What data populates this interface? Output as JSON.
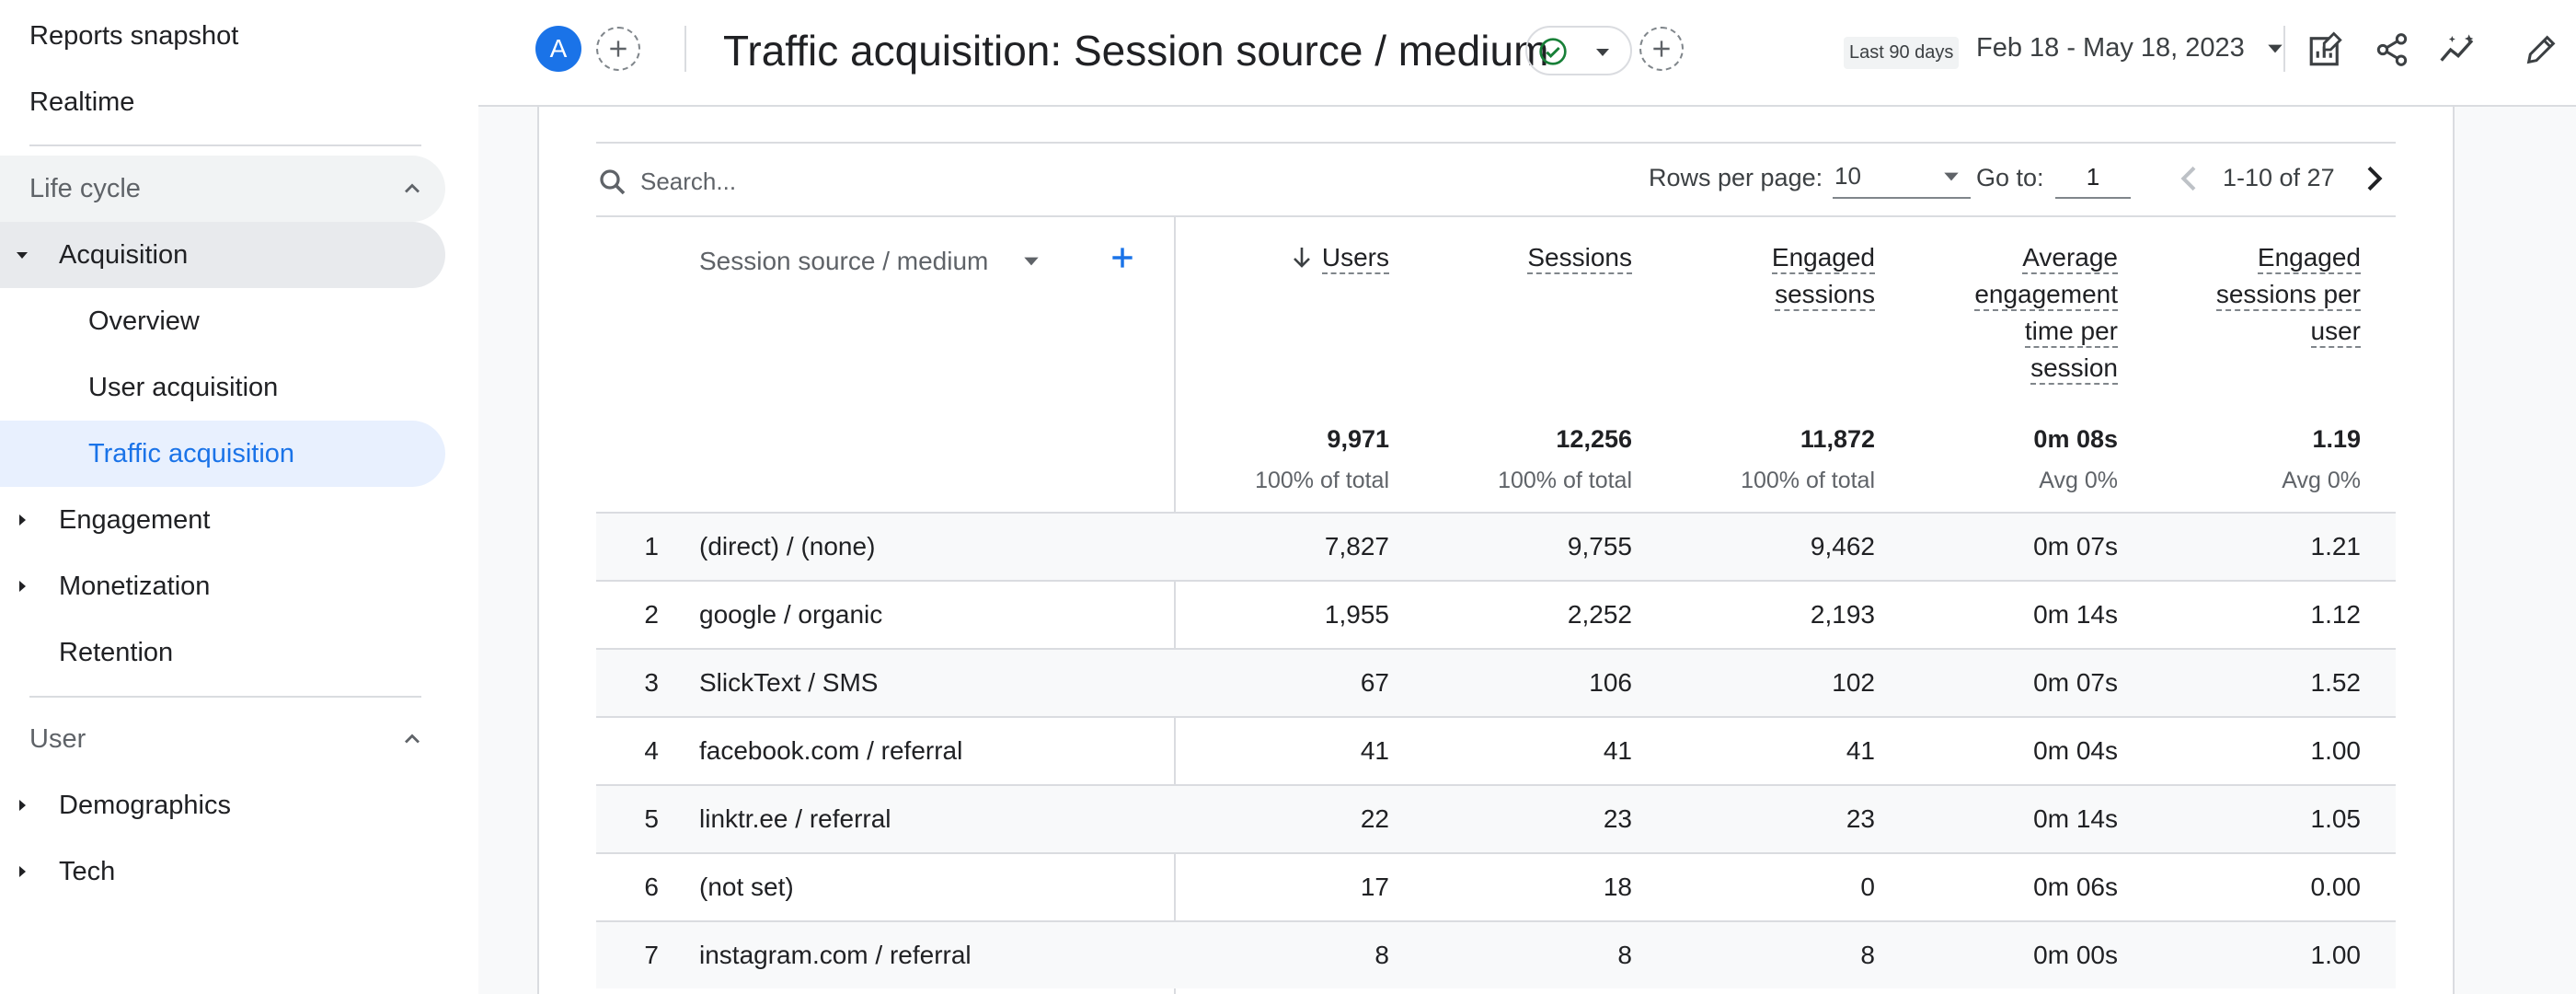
{
  "sidebar": {
    "reports_snapshot": "Reports snapshot",
    "realtime": "Realtime",
    "life_cycle": {
      "title": "Life cycle",
      "acquisition": "Acquisition",
      "overview": "Overview",
      "user_acquisition": "User acquisition",
      "traffic_acquisition": "Traffic acquisition",
      "engagement": "Engagement",
      "monetization": "Monetization",
      "retention": "Retention"
    },
    "user": {
      "title": "User",
      "demographics": "Demographics",
      "tech": "Tech"
    }
  },
  "header": {
    "avatar_letter": "A",
    "title": "Traffic acquisition: Session source / medium",
    "date_preset": "Last 90 days",
    "date_range": "Feb 18 - May 18, 2023"
  },
  "toolbar": {
    "search_placeholder": "Search...",
    "rows_per_page_label": "Rows per page:",
    "rows_per_page_value": "10",
    "goto_label": "Go to:",
    "goto_value": "1",
    "pager_text": "1-10 of 27"
  },
  "table": {
    "dimension_header": "Session source / medium",
    "columns": [
      {
        "lines": [
          "Users"
        ],
        "total": "9,971",
        "sub": "100% of total"
      },
      {
        "lines": [
          "Sessions"
        ],
        "total": "12,256",
        "sub": "100% of total"
      },
      {
        "lines": [
          "Engaged",
          "sessions"
        ],
        "total": "11,872",
        "sub": "100% of total"
      },
      {
        "lines": [
          "Average",
          "engagement",
          "time per",
          "session"
        ],
        "total": "0m 08s",
        "sub": "Avg 0%"
      },
      {
        "lines": [
          "Engaged",
          "sessions per",
          "user"
        ],
        "total": "1.19",
        "sub": "Avg 0%"
      }
    ],
    "rows": [
      {
        "idx": "1",
        "source": "(direct) / (none)",
        "values": [
          "7,827",
          "9,755",
          "9,462",
          "0m 07s",
          "1.21"
        ]
      },
      {
        "idx": "2",
        "source": "google / organic",
        "values": [
          "1,955",
          "2,252",
          "2,193",
          "0m 14s",
          "1.12"
        ]
      },
      {
        "idx": "3",
        "source": "SlickText / SMS",
        "values": [
          "67",
          "106",
          "102",
          "0m 07s",
          "1.52"
        ]
      },
      {
        "idx": "4",
        "source": "facebook.com / referral",
        "values": [
          "41",
          "41",
          "41",
          "0m 04s",
          "1.00"
        ]
      },
      {
        "idx": "5",
        "source": "linktr.ee / referral",
        "values": [
          "22",
          "23",
          "23",
          "0m 14s",
          "1.05"
        ]
      },
      {
        "idx": "6",
        "source": "(not set)",
        "values": [
          "17",
          "18",
          "0",
          "0m 06s",
          "0.00"
        ]
      },
      {
        "idx": "7",
        "source": "instagram.com / referral",
        "values": [
          "8",
          "8",
          "8",
          "0m 00s",
          "1.00"
        ]
      }
    ]
  },
  "colors": {
    "accent": "#1a73e8",
    "active_bg": "#e8f0fe",
    "status_green": "#188038"
  }
}
